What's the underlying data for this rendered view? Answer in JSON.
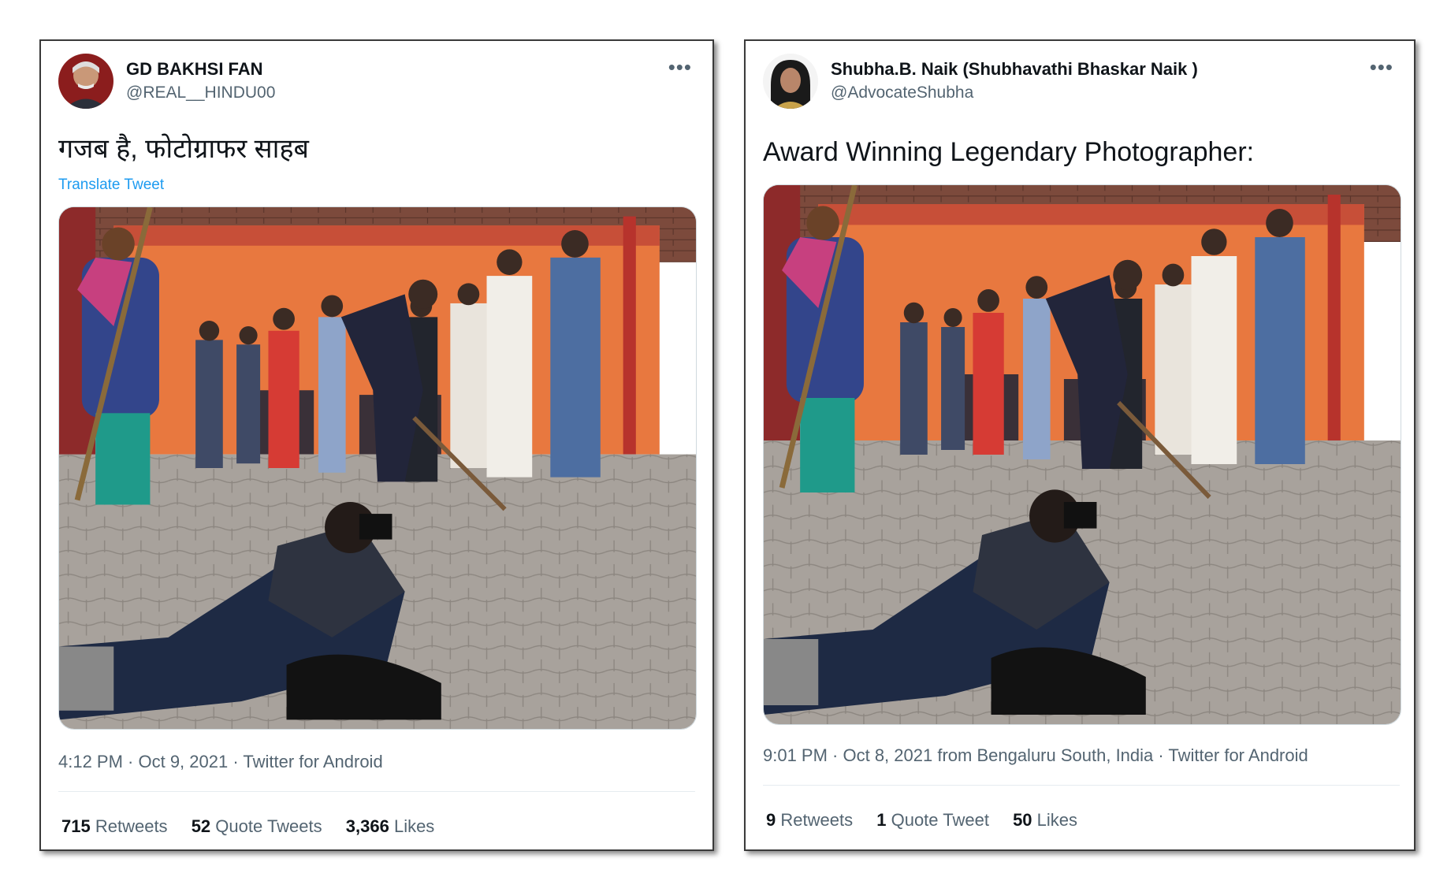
{
  "tweets": [
    {
      "display_name": "GD BAKHSI FAN",
      "handle": "@REAL__HINDU00",
      "text": "गजब है, फोटोग्राफर साहब",
      "translate": "Translate Tweet",
      "meta": "4:12 PM · Oct 9, 2021 · Twitter for Android",
      "retweets_count": "715",
      "retweets_label": "Retweets",
      "quotes_count": "52",
      "quotes_label": "Quote Tweets",
      "likes_count": "3,366",
      "likes_label": "Likes"
    },
    {
      "display_name": "Shubha.B. Naik (Shubhavathi Bhaskar Naik )",
      "handle": "@AdvocateShubha",
      "text": "Award Winning Legendary Photographer:",
      "meta": "9:01 PM · Oct 8, 2021 from Bengaluru South, India · Twitter for Android",
      "retweets_count": "9",
      "retweets_label": "Retweets",
      "quotes_count": "1",
      "quotes_label": "Quote Tweet",
      "likes_count": "50",
      "likes_label": "Likes"
    }
  ],
  "icons": {
    "more": "more-horizontal-icon"
  },
  "colors": {
    "link": "#1d9bf0",
    "secondary_text": "#536471",
    "wall": "#e8783f",
    "ground": "#a8a29c"
  }
}
